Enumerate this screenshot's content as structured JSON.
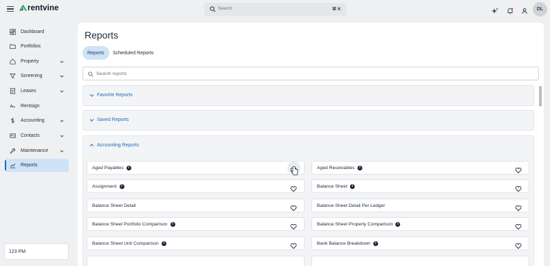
{
  "app": {
    "brand": "rentvine"
  },
  "topbar": {
    "search_placeholder": "Search",
    "search_shortcut": "⌘ K",
    "icons": [
      "sparkle-icon",
      "bell-icon",
      "user-icon"
    ],
    "avatar_initials": "DL"
  },
  "sidebar": {
    "items": [
      {
        "label": "Dashboard",
        "icon": "dashboard-icon",
        "has_chevron": false
      },
      {
        "label": "Portfolios",
        "icon": "folder-icon",
        "has_chevron": false
      },
      {
        "label": "Property",
        "icon": "home-icon",
        "has_chevron": true
      },
      {
        "label": "Screening",
        "icon": "filter-icon",
        "has_chevron": true
      },
      {
        "label": "Leases",
        "icon": "document-icon",
        "has_chevron": true
      },
      {
        "label": "Rentsign",
        "icon": "signature-icon",
        "has_chevron": false
      },
      {
        "label": "Accounting",
        "icon": "dollar-icon",
        "has_chevron": true
      },
      {
        "label": "Contacts",
        "icon": "contact-card-icon",
        "has_chevron": true
      },
      {
        "label": "Maintenance",
        "icon": "wrench-icon",
        "has_chevron": true
      },
      {
        "label": "Reports",
        "icon": "chart-icon",
        "has_chevron": false,
        "active": true
      }
    ],
    "time_display": "123 PM"
  },
  "main": {
    "title": "Reports",
    "tabs": [
      {
        "label": "Reports",
        "active": true
      },
      {
        "label": "Scheduled Reports",
        "active": false
      }
    ],
    "search_placeholder": "Search reports",
    "sections": [
      {
        "label": "Favorite Reports",
        "expanded": false
      },
      {
        "label": "Saved Reports",
        "expanded": false
      },
      {
        "label": "Accounting Reports",
        "expanded": true
      }
    ],
    "reports_left": [
      {
        "name": "Aged Payables",
        "info": true
      },
      {
        "name": "Assignment",
        "info": true
      },
      {
        "name": "Balance Sheet Detail",
        "info": false
      },
      {
        "name": "Balance Sheet Portfolio Comparison",
        "info": true
      },
      {
        "name": "Balance Sheet Unit Comparison",
        "info": true
      }
    ],
    "reports_right": [
      {
        "name": "Aged Receivables",
        "info": true
      },
      {
        "name": "Balance Sheet",
        "info": true
      },
      {
        "name": "Balance Sheet Detail Per Ledger",
        "info": false
      },
      {
        "name": "Balance Sheet Property Comparison",
        "info": true
      },
      {
        "name": "Bank Balance Breakdown",
        "info": true
      }
    ]
  },
  "colors": {
    "accent": "#1e6bb8",
    "active_bg": "#cfe3f7",
    "page_bg": "#eef0f2"
  }
}
